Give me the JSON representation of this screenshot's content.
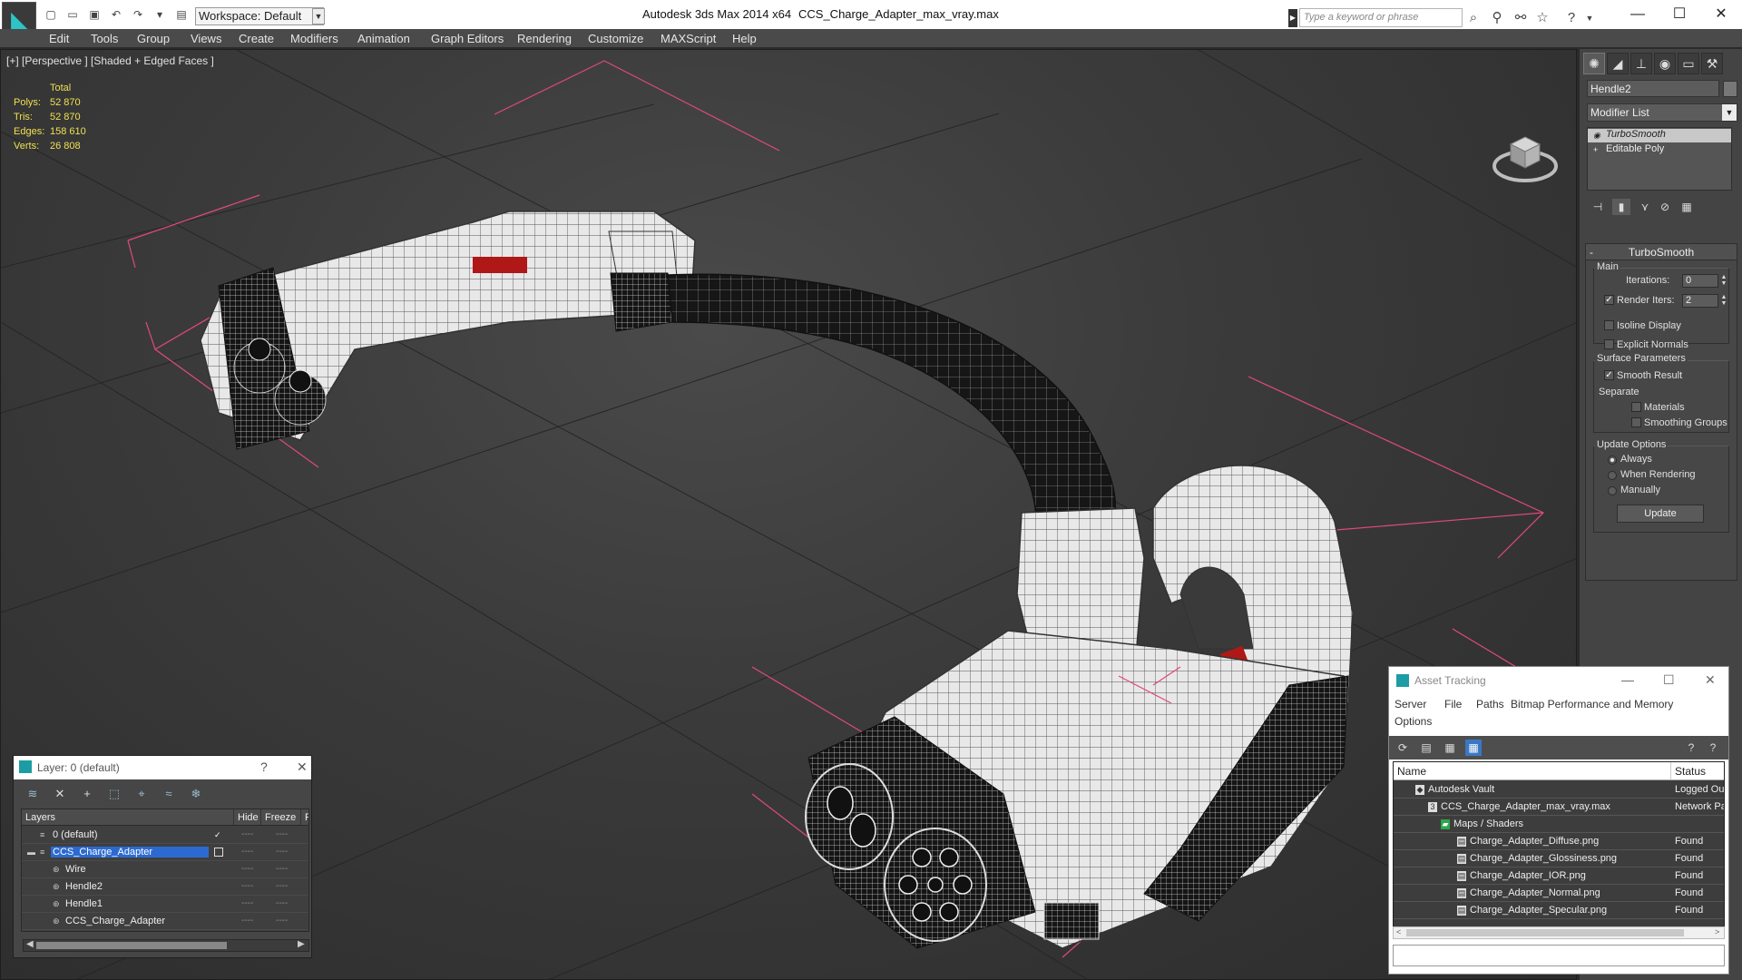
{
  "titlebar": {
    "workspace_label": "Workspace: Default",
    "app_title": "Autodesk 3ds Max  2014 x64",
    "file_title": "CCS_Charge_Adapter_max_vray.max",
    "search_placeholder": "Type a keyword or phrase"
  },
  "menu": [
    "Edit",
    "Tools",
    "Group",
    "Views",
    "Create",
    "Modifiers",
    "Animation",
    "Graph Editors",
    "Rendering",
    "Customize",
    "MAXScript",
    "Help"
  ],
  "viewport": {
    "label": "[+] [Perspective ] [Shaded + Edged Faces ]",
    "stats_header": "Total",
    "stats": [
      {
        "label": "Polys:",
        "value": "52 870"
      },
      {
        "label": "Tris:",
        "value": "52 870"
      },
      {
        "label": "Edges:",
        "value": "158 610"
      },
      {
        "label": "Verts:",
        "value": "26 808"
      }
    ]
  },
  "command_panel": {
    "object_name": "Hendle2",
    "modifier_list": "Modifier List",
    "stack": [
      "TurboSmooth",
      "Editable Poly"
    ],
    "rollout_title": "TurboSmooth",
    "main_group": "Main",
    "iterations_label": "Iterations:",
    "iterations_value": "0",
    "render_iters_label": "Render Iters:",
    "render_iters_value": "2",
    "isoline_label": "Isoline Display",
    "explicit_normals_label": "Explicit Normals",
    "surface_group": "Surface Parameters",
    "smooth_result_label": "Smooth Result",
    "separate_label": "Separate",
    "materials_label": "Materials",
    "smoothing_groups_label": "Smoothing Groups",
    "update_group": "Update Options",
    "always_label": "Always",
    "when_rendering_label": "When Rendering",
    "manually_label": "Manually",
    "update_button": "Update"
  },
  "layer_dialog": {
    "title": "Layer: 0 (default)",
    "help": "?",
    "close": "✕",
    "col_layers": "Layers",
    "col_hide": "Hide",
    "col_freeze": "Freeze",
    "col_r": "R",
    "rows": [
      {
        "name": "0 (default)",
        "indent": 0,
        "checked": true
      },
      {
        "name": "CCS_Charge_Adapter",
        "indent": 0,
        "selected": true
      },
      {
        "name": "Wire",
        "indent": 1
      },
      {
        "name": "Hendle2",
        "indent": 1
      },
      {
        "name": "Hendle1",
        "indent": 1
      },
      {
        "name": "CCS_Charge_Adapter",
        "indent": 1
      }
    ]
  },
  "asset_dialog": {
    "title": "Asset Tracking",
    "menu": [
      "Server",
      "File",
      "Paths",
      "Bitmap Performance and Memory",
      "Options"
    ],
    "col_name": "Name",
    "col_status": "Status",
    "rows": [
      {
        "name": "Autodesk Vault",
        "status": "Logged Out",
        "indent": 1
      },
      {
        "name": "CCS_Charge_Adapter_max_vray.max",
        "status": "Network Path",
        "indent": 2
      },
      {
        "name": "Maps / Shaders",
        "status": "",
        "indent": 3
      },
      {
        "name": "Charge_Adapter_Diffuse.png",
        "status": "Found",
        "indent": 4
      },
      {
        "name": "Charge_Adapter_Glossiness.png",
        "status": "Found",
        "indent": 4
      },
      {
        "name": "Charge_Adapter_IOR.png",
        "status": "Found",
        "indent": 4
      },
      {
        "name": "Charge_Adapter_Normal.png",
        "status": "Found",
        "indent": 4
      },
      {
        "name": "Charge_Adapter_Specular.png",
        "status": "Found",
        "indent": 4
      }
    ]
  },
  "colors": {
    "accent": "#2c6ad2",
    "stats_yellow": "#f0e050",
    "selection_pink": "#e04a7a",
    "logo_teal": "#1d9ca3"
  }
}
